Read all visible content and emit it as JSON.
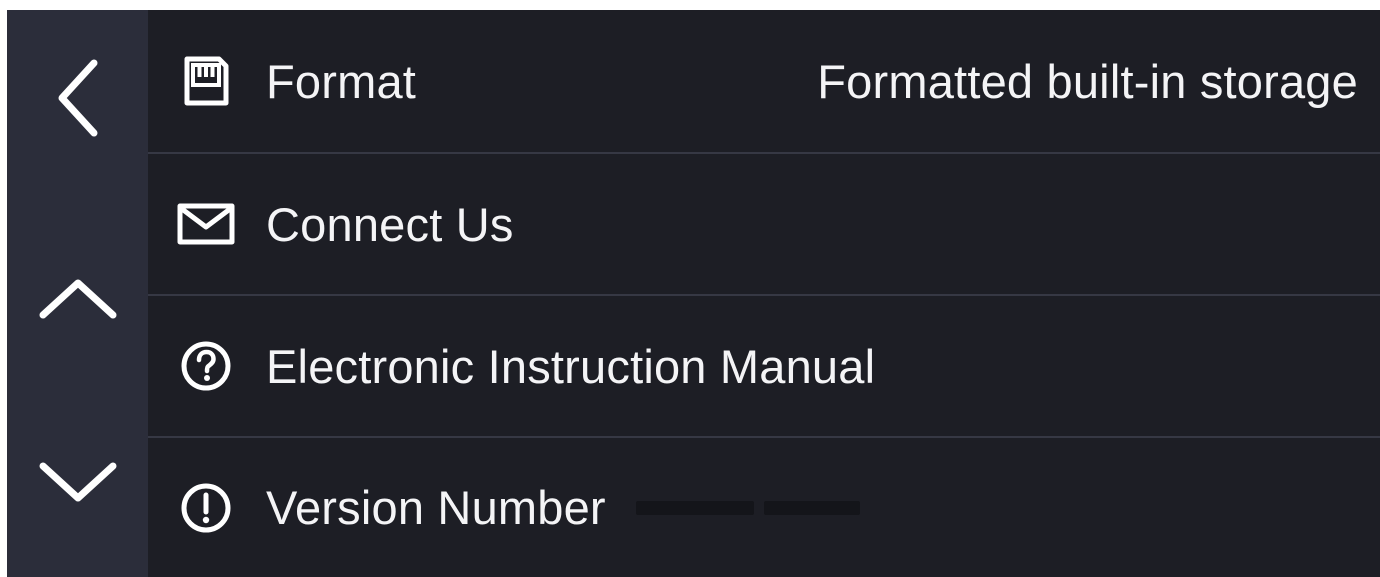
{
  "nav": {
    "back_icon": "chevron-left-icon",
    "up_icon": "chevron-up-icon",
    "down_icon": "chevron-down-icon"
  },
  "menu": {
    "items": [
      {
        "icon": "sd-card-icon",
        "label": "Format",
        "value": "Formatted built-in storage"
      },
      {
        "icon": "mail-icon",
        "label": "Connect Us",
        "value": ""
      },
      {
        "icon": "help-circle-icon",
        "label": "Electronic Instruction Manual",
        "value": ""
      },
      {
        "icon": "info-circle-icon",
        "label": "Version Number",
        "value": ""
      }
    ]
  },
  "colors": {
    "background": "#1d1e25",
    "rail": "#2b2d3a",
    "divider": "#363844",
    "text": "#f4f4f6"
  }
}
